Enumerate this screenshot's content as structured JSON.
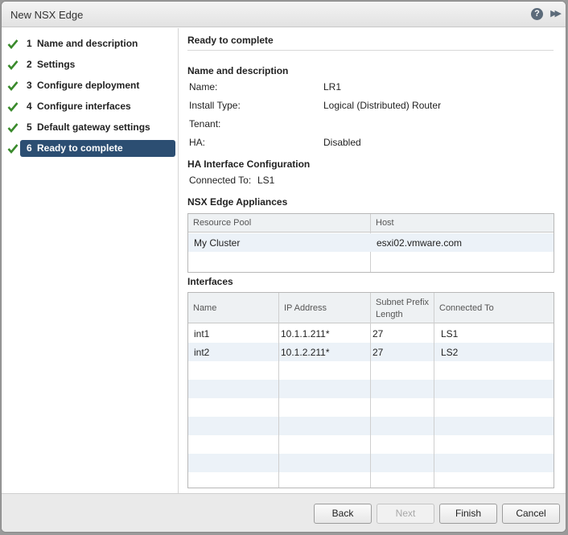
{
  "window": {
    "title": "New NSX Edge",
    "help_symbol": "?",
    "expand_symbol": "▶▶"
  },
  "nav": {
    "items": [
      {
        "num": "1",
        "label": "Name and description",
        "done": true
      },
      {
        "num": "2",
        "label": "Settings",
        "done": true
      },
      {
        "num": "3",
        "label": "Configure deployment",
        "done": true
      },
      {
        "num": "4",
        "label": "Configure interfaces",
        "done": true
      },
      {
        "num": "5",
        "label": "Default gateway settings",
        "done": true
      },
      {
        "num": "6",
        "label": "Ready to complete",
        "done": true,
        "active": true
      }
    ]
  },
  "content": {
    "title": "Ready to complete",
    "name_section": {
      "heading": "Name and description",
      "rows": [
        {
          "label": "Name:",
          "value": "LR1"
        },
        {
          "label": "Install Type:",
          "value": "Logical (Distributed) Router"
        },
        {
          "label": "Tenant:",
          "value": ""
        },
        {
          "label": "HA:",
          "value": "Disabled"
        }
      ]
    },
    "ha_section": {
      "heading": "HA Interface Configuration",
      "label": "Connected To:",
      "value": "LS1"
    },
    "appliances": {
      "heading": "NSX Edge Appliances",
      "columns": [
        "Resource Pool",
        "Host"
      ],
      "rows": [
        [
          "My Cluster",
          "esxi02.vmware.com"
        ]
      ]
    },
    "interfaces": {
      "heading": "Interfaces",
      "columns": [
        "Name",
        "IP Address",
        "Subnet Prefix Length",
        "Connected To"
      ],
      "column_lines": [
        [
          "",
          ""
        ],
        [
          "",
          ""
        ],
        [
          "Subnet Prefix",
          "Length"
        ],
        [
          "",
          ""
        ]
      ],
      "rows": [
        [
          "int1",
          "10.1.1.211*",
          "27",
          "LS1"
        ],
        [
          "int2",
          "10.1.2.211*",
          "27",
          "LS2"
        ]
      ]
    }
  },
  "footer": {
    "back": "Back",
    "next": "Next",
    "finish": "Finish",
    "cancel": "Cancel"
  },
  "colors": {
    "active_nav": "#2c4e72",
    "check": "#3a8a2c",
    "row_alt": "#ecf2f8"
  }
}
